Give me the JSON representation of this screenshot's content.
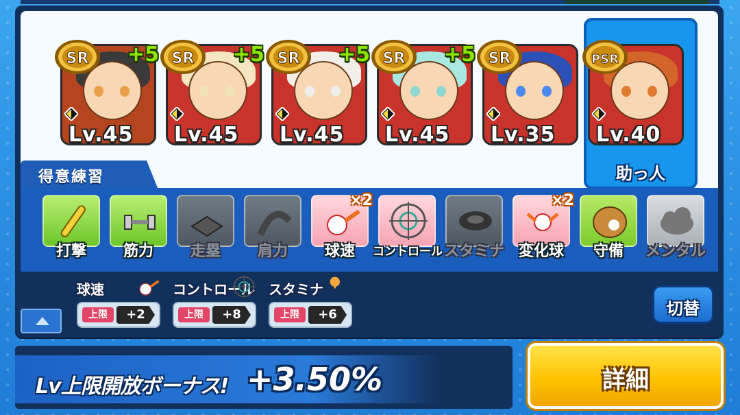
{
  "cards": [
    {
      "rarity": "SR",
      "bonus": "+5",
      "level": "Lv.45",
      "palette": [
        "#b5451f",
        "#3a3a3a",
        "#e8a04a"
      ]
    },
    {
      "rarity": "SR",
      "bonus": "+5",
      "level": "Lv.45",
      "palette": [
        "#c8332b",
        "#f4e6c0",
        "#f2e2b8"
      ]
    },
    {
      "rarity": "SR",
      "bonus": "+5",
      "level": "Lv.45",
      "palette": [
        "#c8332b",
        "#f1efe8",
        "#eeeeee"
      ]
    },
    {
      "rarity": "SR",
      "bonus": "+5",
      "level": "Lv.45",
      "palette": [
        "#c8332b",
        "#a9e8e0",
        "#8fd6cf"
      ]
    },
    {
      "rarity": "SR",
      "bonus": "",
      "level": "Lv.35",
      "palette": [
        "#c8332b",
        "#2d4fb8",
        "#4a8aef"
      ]
    },
    {
      "rarity": "PSR",
      "bonus": "",
      "level": "Lv.40",
      "palette": [
        "#c8332b",
        "#d4652a",
        "#e07a30"
      ]
    }
  ],
  "helper_label": "助っ人",
  "practice_title": "得意練習",
  "practice_items": [
    {
      "label": "打撃",
      "state": "on",
      "multiplier": "",
      "icon": "bat-icon"
    },
    {
      "label": "筋力",
      "state": "on",
      "multiplier": "",
      "icon": "dumbbell-icon"
    },
    {
      "label": "走塁",
      "state": "off",
      "multiplier": "",
      "icon": "base-icon"
    },
    {
      "label": "肩力",
      "state": "off",
      "multiplier": "",
      "icon": "ball-arm-icon"
    },
    {
      "label": "球速",
      "state": "pink",
      "multiplier": "×2",
      "icon": "fastball-icon"
    },
    {
      "label": "コントロール",
      "state": "pink",
      "multiplier": "",
      "icon": "target-icon"
    },
    {
      "label": "スタミナ",
      "state": "off",
      "multiplier": "",
      "icon": "tire-icon"
    },
    {
      "label": "変化球",
      "state": "pink",
      "multiplier": "×2",
      "icon": "breaking-ball-icon"
    },
    {
      "label": "守備",
      "state": "green2",
      "multiplier": "",
      "icon": "glove-icon"
    },
    {
      "label": "メンタル",
      "state": "gray",
      "multiplier": "",
      "icon": "cloud-icon"
    }
  ],
  "limits": [
    {
      "name": "球速",
      "tag": "上限",
      "value": "+2",
      "icon": "fastball-icon"
    },
    {
      "name": "コントロール",
      "tag": "上限",
      "value": "+8",
      "icon": "target-icon"
    },
    {
      "name": "スタミナ",
      "tag": "上限",
      "value": "+6",
      "icon": "stamina-icon"
    }
  ],
  "switch_label": "切替",
  "bonus_label": "Lv上限開放ボーナス!",
  "bonus_value": "+3.50%",
  "detail_label": "詳細"
}
